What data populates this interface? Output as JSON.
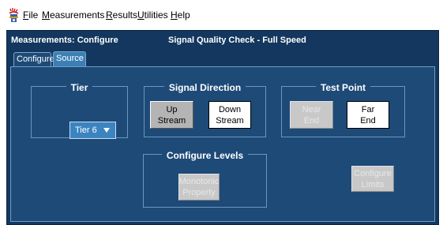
{
  "menu": {
    "items": [
      {
        "mnemonic": "F",
        "rest": "ile"
      },
      {
        "mnemonic": "M",
        "rest": "easurements"
      },
      {
        "mnemonic": "R",
        "rest": "esults"
      },
      {
        "mnemonic": "U",
        "rest": "tilities"
      },
      {
        "mnemonic": "H",
        "rest": "elp"
      }
    ]
  },
  "panel": {
    "title": "Measurements: Configure",
    "subtitle": "Signal Quality Check  -  Full Speed",
    "tabs": [
      "Configure",
      "Source"
    ]
  },
  "tier": {
    "title": "Tier",
    "selected": "Tier 6"
  },
  "signal_direction": {
    "title": "Signal Direction",
    "up": [
      "Up",
      "Stream"
    ],
    "down": [
      "Down",
      "Stream"
    ]
  },
  "test_point": {
    "title": "Test Point",
    "near": [
      "Near",
      "End"
    ],
    "far": [
      "Far",
      "End"
    ]
  },
  "configure_levels": {
    "title": "Configure Levels",
    "monotonic": [
      "Monotonic",
      "Property"
    ]
  },
  "configure_limits": [
    "Configure",
    "Limits"
  ],
  "colors": {
    "panel_bg": "#13375e",
    "content_bg": "#1e4a78",
    "tab_active": "#3b7fb5",
    "dropdown_bg": "#3c84c0"
  }
}
